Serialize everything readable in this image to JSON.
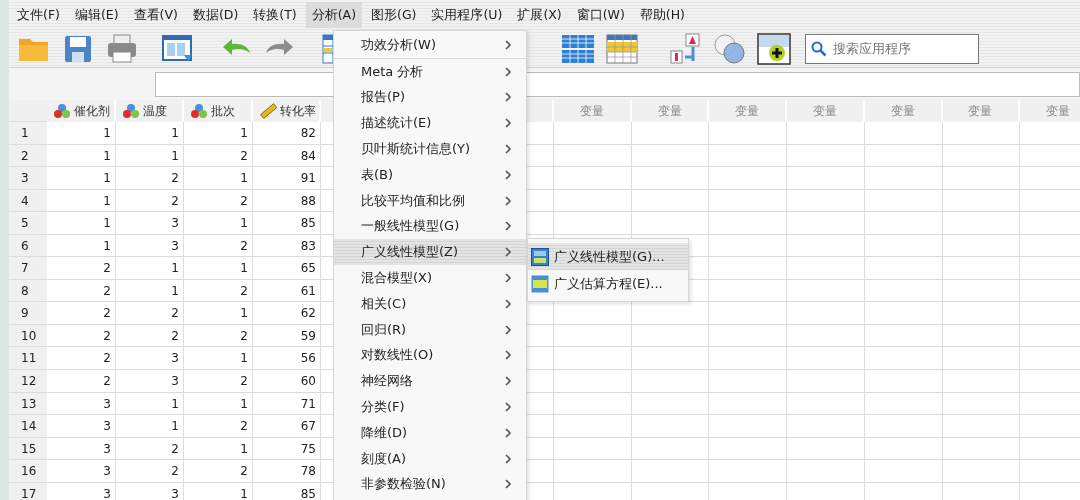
{
  "menu_bar": [
    {
      "label": "文件(F)",
      "selected": false
    },
    {
      "label": "编辑(E)",
      "selected": false
    },
    {
      "label": "查看(V)",
      "selected": false
    },
    {
      "label": "数据(D)",
      "selected": false
    },
    {
      "label": "转换(T)",
      "selected": false
    },
    {
      "label": "分析(A)",
      "selected": true
    },
    {
      "label": "图形(G)",
      "selected": false
    },
    {
      "label": "实用程序(U)",
      "selected": false
    },
    {
      "label": "扩展(X)",
      "selected": false
    },
    {
      "label": "窗口(W)",
      "selected": false
    },
    {
      "label": "帮助(H)",
      "selected": false
    }
  ],
  "toolbar": {
    "search": {
      "placeholder": "搜索应用程序"
    }
  },
  "grid": {
    "columns": [
      {
        "label": "催化剂",
        "kind": "nominal"
      },
      {
        "label": "温度",
        "kind": "nominal"
      },
      {
        "label": "批次",
        "kind": "nominal"
      },
      {
        "label": "转化率",
        "kind": "scale"
      }
    ],
    "empty_columns": [
      "变量",
      "变量",
      "变量",
      "变量",
      "变量",
      "变量",
      "变量"
    ],
    "rows": [
      {
        "number": "1",
        "cells": [
          "1",
          "1",
          "1",
          "82"
        ]
      },
      {
        "number": "2",
        "cells": [
          "1",
          "1",
          "2",
          "84"
        ]
      },
      {
        "number": "3",
        "cells": [
          "1",
          "2",
          "1",
          "91"
        ]
      },
      {
        "number": "4",
        "cells": [
          "1",
          "2",
          "2",
          "88"
        ]
      },
      {
        "number": "5",
        "cells": [
          "1",
          "3",
          "1",
          "85"
        ]
      },
      {
        "number": "6",
        "cells": [
          "1",
          "3",
          "2",
          "83"
        ]
      },
      {
        "number": "7",
        "cells": [
          "2",
          "1",
          "1",
          "65"
        ]
      },
      {
        "number": "8",
        "cells": [
          "2",
          "1",
          "2",
          "61"
        ]
      },
      {
        "number": "9",
        "cells": [
          "2",
          "2",
          "1",
          "62"
        ]
      },
      {
        "number": "10",
        "cells": [
          "2",
          "2",
          "2",
          "59"
        ]
      },
      {
        "number": "11",
        "cells": [
          "2",
          "3",
          "1",
          "56"
        ]
      },
      {
        "number": "12",
        "cells": [
          "2",
          "3",
          "2",
          "60"
        ]
      },
      {
        "number": "13",
        "cells": [
          "3",
          "1",
          "1",
          "71"
        ]
      },
      {
        "number": "14",
        "cells": [
          "3",
          "1",
          "2",
          "67"
        ]
      },
      {
        "number": "15",
        "cells": [
          "3",
          "2",
          "1",
          "75"
        ]
      },
      {
        "number": "16",
        "cells": [
          "3",
          "2",
          "2",
          "78"
        ]
      },
      {
        "number": "17",
        "cells": [
          "3",
          "3",
          "1",
          "85"
        ]
      }
    ]
  },
  "analyze_menu": {
    "items": [
      {
        "label": "功效分析(W)",
        "selected": false,
        "separator_after": true
      },
      {
        "label": "Meta 分析",
        "selected": false,
        "separator_after": false
      },
      {
        "label": "报告(P)",
        "selected": false,
        "separator_after": false
      },
      {
        "label": "描述统计(E)",
        "selected": false,
        "separator_after": false
      },
      {
        "label": "贝叶斯统计信息(Y)",
        "selected": false,
        "separator_after": false
      },
      {
        "label": "表(B)",
        "selected": false,
        "separator_after": false
      },
      {
        "label": "比较平均值和比例",
        "selected": false,
        "separator_after": false
      },
      {
        "label": "一般线性模型(G)",
        "selected": false,
        "separator_after": false
      },
      {
        "label": "广义线性模型(Z)",
        "selected": true,
        "separator_after": false
      },
      {
        "label": "混合模型(X)",
        "selected": false,
        "separator_after": false
      },
      {
        "label": "相关(C)",
        "selected": false,
        "separator_after": false
      },
      {
        "label": "回归(R)",
        "selected": false,
        "separator_after": false
      },
      {
        "label": "对数线性(O)",
        "selected": false,
        "separator_after": false
      },
      {
        "label": "神经网络",
        "selected": false,
        "separator_after": false
      },
      {
        "label": "分类(F)",
        "selected": false,
        "separator_after": false
      },
      {
        "label": "降维(D)",
        "selected": false,
        "separator_after": false
      },
      {
        "label": "刻度(A)",
        "selected": false,
        "separator_after": false
      },
      {
        "label": "非参数检验(N)",
        "selected": false,
        "separator_after": false
      }
    ]
  },
  "submenu": {
    "items": [
      {
        "label": "广义线性模型(G)...",
        "kind": "glm",
        "selected": true
      },
      {
        "label": "广义估算方程(E)...",
        "kind": "gee",
        "selected": false
      }
    ]
  }
}
